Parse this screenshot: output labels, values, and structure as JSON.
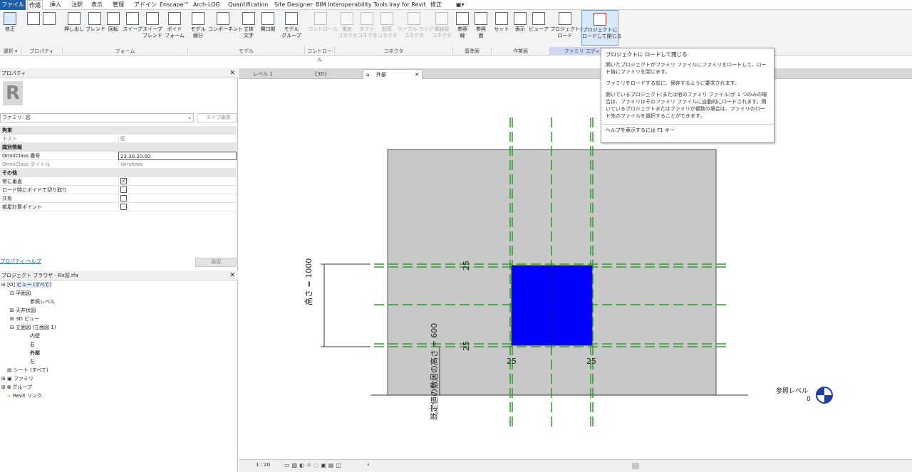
{
  "menu": {
    "tabs": [
      "ファイル",
      "作成",
      "挿入",
      "注釈",
      "表示",
      "管理",
      "アドイン",
      "Enscape™",
      "Arch-LOG",
      "Quantification",
      "Site Designer",
      "BIM Interoperability Tools",
      "Iray for Revit",
      "修正",
      "▣▾"
    ]
  },
  "ribbon": {
    "buttons": [
      {
        "l1": "修正",
        "l2": "",
        "dis": false
      },
      {
        "l1": "押し出し",
        "l2": "",
        "dis": false
      },
      {
        "l1": "ブレンド",
        "l2": "",
        "dis": false
      },
      {
        "l1": "回転",
        "l2": "",
        "dis": false
      },
      {
        "l1": "スイープ",
        "l2": "",
        "dis": false
      },
      {
        "l1": "スイープ",
        "l2": "ブレンド",
        "dis": false
      },
      {
        "l1": "ボイド",
        "l2": "フォーム",
        "dis": false
      },
      {
        "l1": "モデル",
        "l2": "線分",
        "dis": false
      },
      {
        "l1": "コンポーネント",
        "l2": "",
        "dis": false
      },
      {
        "l1": "立体",
        "l2": "文字",
        "dis": false
      },
      {
        "l1": "開口部",
        "l2": "",
        "dis": false
      },
      {
        "l1": "モデル",
        "l2": "グループ",
        "dis": false
      },
      {
        "l1": "コントロール",
        "l2": "",
        "dis": true
      },
      {
        "l1": "電気",
        "l2": "コネクタ",
        "dis": true
      },
      {
        "l1": "ダクト",
        "l2": "コネクタ",
        "dis": true
      },
      {
        "l1": "配管",
        "l2": "コネクタ",
        "dis": true
      },
      {
        "l1": "ケーブル ラック",
        "l2": "コネクタ",
        "dis": true
      },
      {
        "l1": "電線管",
        "l2": "コネクタ",
        "dis": true
      },
      {
        "l1": "参照",
        "l2": "線",
        "dis": false
      },
      {
        "l1": "参照",
        "l2": "面",
        "dis": false
      },
      {
        "l1": "セット",
        "l2": "",
        "dis": false
      },
      {
        "l1": "表示",
        "l2": "",
        "dis": false
      },
      {
        "l1": "ビューア",
        "l2": "",
        "dis": false
      },
      {
        "l1": "プロジェクトに",
        "l2": "ロード",
        "dis": false
      },
      {
        "l1": "プロジェクトに",
        "l2": "ロードして閉じる",
        "dis": false
      }
    ],
    "panels": [
      "選択 ▾",
      "プロパティ",
      "フォーム",
      "モデル",
      "コントロール",
      "コネクタ",
      "基準面",
      "作業面",
      "ファミリ エディタ"
    ]
  },
  "properties": {
    "title": "プロパティ",
    "family_select": "ファミリ: 窓",
    "edit_type": "タイプ編集",
    "groups": {
      "constraints": "拘束",
      "identity": "識別情報",
      "other": "その他"
    },
    "rows": {
      "host_k": "ホスト",
      "host_v": "壁",
      "omni_k": "OmniClass 番号",
      "omni_v": "23.30.20.00",
      "omnititle_k": "OmniClass タイトル",
      "omnititle_v": "Windows",
      "vert_k": "常に垂直",
      "void_k": "ロード時にボイドで切り取り",
      "shared_k": "共有",
      "room_k": "部屋計算ポイント"
    },
    "help": "プロパティ ヘルプ",
    "apply": "適用"
  },
  "browser": {
    "title": "プロジェクト ブラウザ - Fix窓.rfa",
    "items": [
      "ビュー (すべて)",
      "平面図",
      "参照レベル",
      "天井伏図",
      "3D ビュー",
      "立面図 (立面図 1)",
      "内壁",
      "右",
      "外部",
      "左",
      "シート (すべて)",
      "ファミリ",
      "グループ",
      "Revit リンク"
    ]
  },
  "tabs": [
    "レベル 1",
    "{3D}",
    "外部"
  ],
  "canvas": {
    "height_label": "高さ = 1000",
    "sill_label": "既定値の敷居の高さ = 600",
    "dim_25": "25",
    "level_name": "参照レベル",
    "level_value": "0"
  },
  "status": {
    "scale": "1 : 20"
  },
  "tooltip": {
    "title": "プロジェクトに ロードして閉じる",
    "p1": "開いたプロジェクトがファミリ ファイルにファミリをロードして、ロード後にファミリを閉じます。",
    "p2": "ファミリをロードする前に、保存するように要求されます。",
    "p3": "開いているプロジェクト(または他のファミリ ファイル)が 1 つのみの場合は、ファミリはそのファミリ ファイルに自動的にロードされます。開いているプロジェクトまたはファミリが複数の場合は、ファミリのロード先のファイルを選択することができます。",
    "help": "ヘルプを表示するには F1 キー"
  },
  "colors": {
    "accent": "#1f5fa8",
    "window_fill": "#0000ff",
    "wall": "#c8c8c8",
    "refplane": "#2e9b2e"
  }
}
